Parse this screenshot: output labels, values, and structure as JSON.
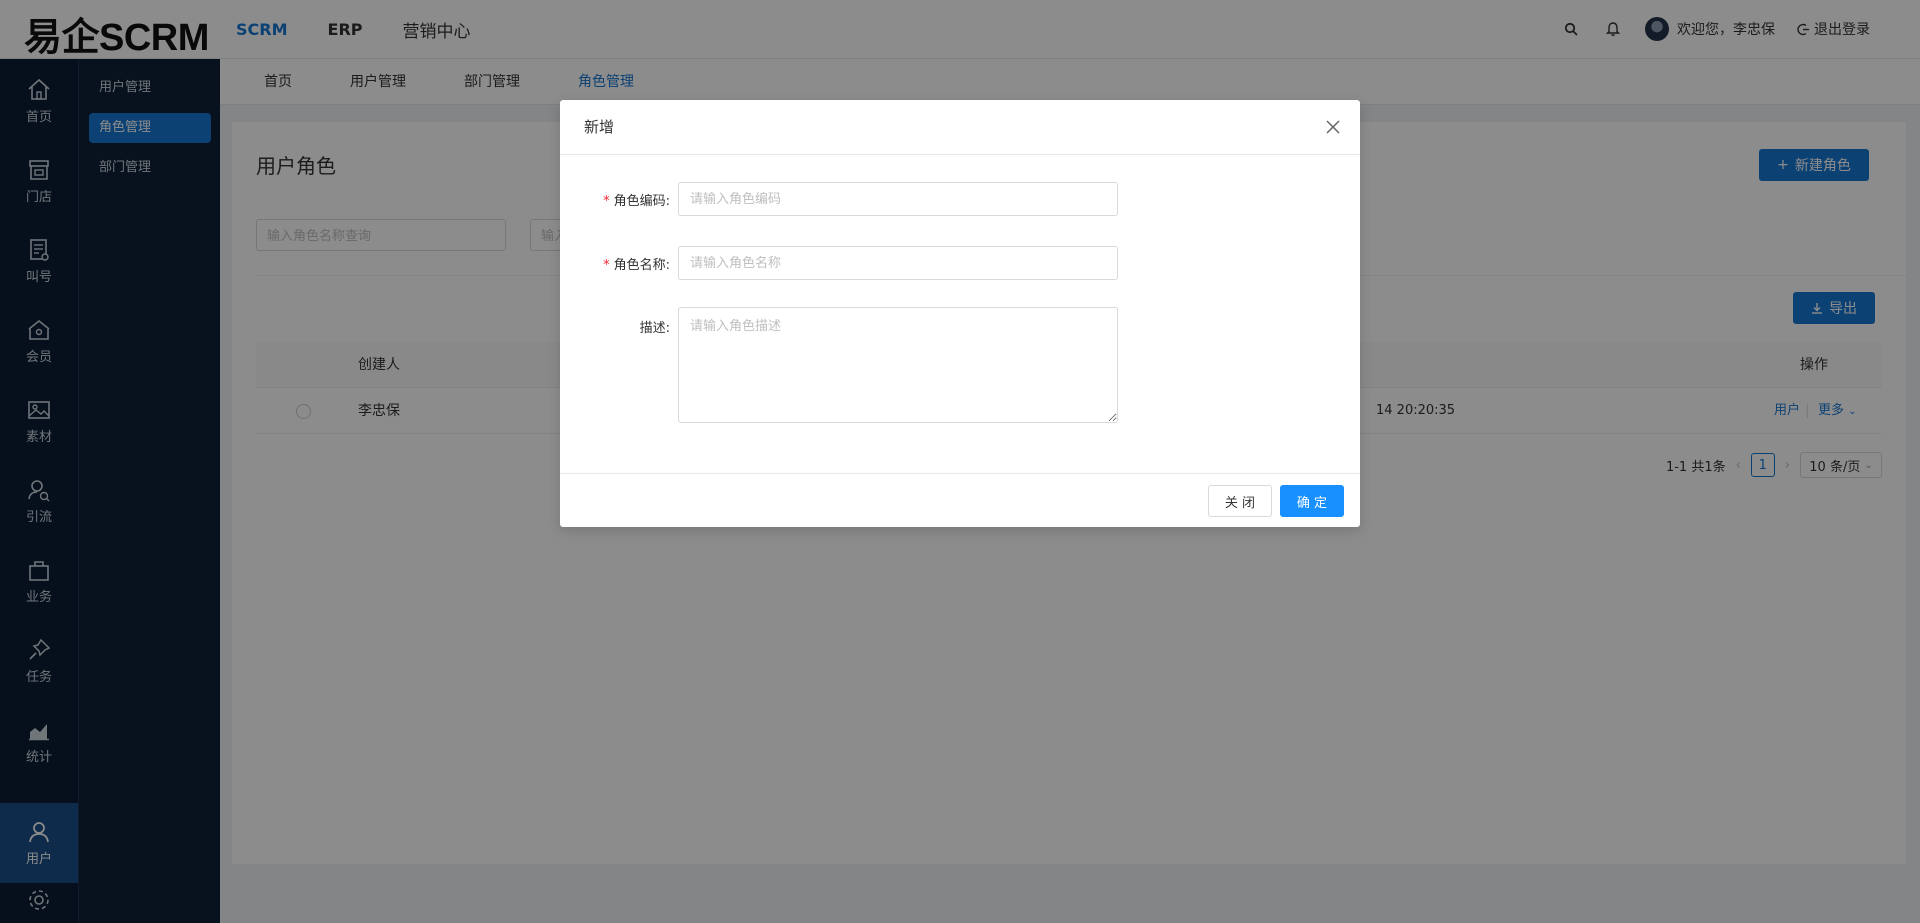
{
  "brand": "易企SCRM",
  "top_nav": [
    {
      "label": "SCRM",
      "active": true
    },
    {
      "label": "ERP",
      "active": false
    },
    {
      "label": "营销中心",
      "active": false
    }
  ],
  "header": {
    "welcome": "欢迎您，李忠保",
    "logout": "退出登录"
  },
  "sidebar_icons": [
    {
      "label": "首页",
      "icon": "home-icon"
    },
    {
      "label": "门店",
      "icon": "store-icon"
    },
    {
      "label": "叫号",
      "icon": "queue-icon"
    },
    {
      "label": "会员",
      "icon": "member-icon"
    },
    {
      "label": "素材",
      "icon": "image-icon"
    },
    {
      "label": "引流",
      "icon": "traffic-icon"
    },
    {
      "label": "业务",
      "icon": "bag-icon"
    },
    {
      "label": "任务",
      "icon": "pin-icon"
    },
    {
      "label": "统计",
      "icon": "chart-icon"
    },
    {
      "label": "用户",
      "icon": "user-icon",
      "active": true
    }
  ],
  "sub_sidebar": [
    {
      "label": "用户管理",
      "active": false
    },
    {
      "label": "角色管理",
      "active": true
    },
    {
      "label": "部门管理",
      "active": false
    }
  ],
  "tabs": [
    {
      "label": "首页"
    },
    {
      "label": "用户管理"
    },
    {
      "label": "部门管理"
    },
    {
      "label": "角色管理",
      "active": true
    }
  ],
  "page": {
    "title": "用户角色",
    "new_role_button": "新建角色",
    "search_name_placeholder": "输入角色名称查询",
    "search_second_placeholder": "输入",
    "export_button": "导出",
    "table": {
      "columns": [
        "创建人",
        "操作"
      ],
      "rows": [
        {
          "creator": "李忠保",
          "time_fragment": "14 20:20:35",
          "action_user": "用户",
          "action_more": "更多"
        }
      ]
    },
    "pagination": {
      "summary": "1-1 共1条",
      "current_page": "1",
      "page_size": "10 条/页"
    }
  },
  "modal": {
    "title": "新增",
    "fields": [
      {
        "label": "角色编码:",
        "required": true,
        "placeholder": "请输入角色编码"
      },
      {
        "label": "角色名称:",
        "required": true,
        "placeholder": "请输入角色名称"
      },
      {
        "label": "描述:",
        "required": false,
        "placeholder": "请输入角色描述"
      }
    ],
    "cancel_button": "关 闭",
    "ok_button": "确 定"
  },
  "colors": {
    "primary": "#1677d2",
    "sidebar_bg": "#0b1c33",
    "required": "#f5222d",
    "mask": "rgba(0,0,0,0.45)"
  }
}
